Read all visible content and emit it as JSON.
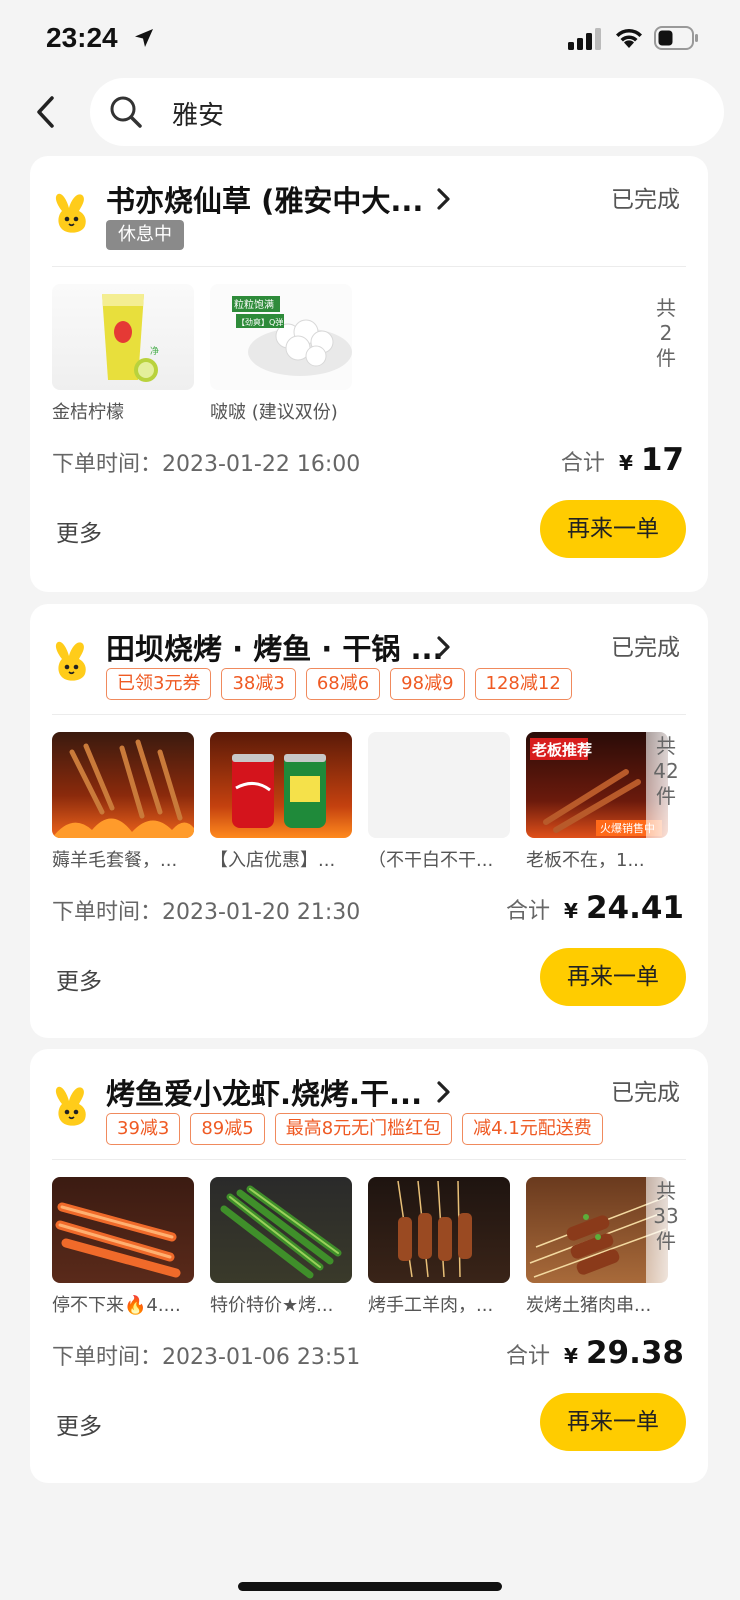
{
  "status_bar": {
    "time": "23:24"
  },
  "search": {
    "query": "雅安"
  },
  "orders": [
    {
      "shop_name": "书亦烧仙草 (雅安中大...",
      "status": "已完成",
      "rest_tag": "休息中",
      "tags": [],
      "items": [
        {
          "name": "金桔柠檬"
        },
        {
          "name": "啵啵 (建议双份)",
          "overlay_text_1": "粒粒饱满",
          "overlay_text_2": "【劲爽】Q弹"
        }
      ],
      "count_prefix": "共",
      "count": "2",
      "count_suffix": "件",
      "order_time_label": "下单时间：",
      "order_time": "2023-01-22 16:00",
      "total_label": "合计",
      "currency": "¥",
      "total": "17",
      "more_label": "更多",
      "reorder_label": "再来一单"
    },
    {
      "shop_name": "田坝烧烤 · 烤鱼 · 干锅 ...",
      "status": "已完成",
      "tags": [
        "已领3元券",
        "38减3",
        "68减6",
        "98减9",
        "128减12"
      ],
      "items": [
        {
          "name": "薅羊毛套餐，..."
        },
        {
          "name": "【入店优惠】..."
        },
        {
          "name": "（不干白不干..."
        },
        {
          "name": "老板不在，1...",
          "overlay_text_1": "老板推荐",
          "overlay_text_2": "火爆销售中"
        }
      ],
      "count_prefix": "共",
      "count": "42",
      "count_suffix": "件",
      "order_time_label": "下单时间：",
      "order_time": "2023-01-20 21:30",
      "total_label": "合计",
      "currency": "¥",
      "total": "24.41",
      "more_label": "更多",
      "reorder_label": "再来一单"
    },
    {
      "shop_name": "烤鱼爱小龙虾.烧烤.干...",
      "status": "已完成",
      "tags": [
        "39减3",
        "89减5",
        "最高8元无门槛红包",
        "减4.1元配送费"
      ],
      "items": [
        {
          "name": "停不下来🔥4...."
        },
        {
          "name": "特价特价★烤..."
        },
        {
          "name": "烤手工羊肉，..."
        },
        {
          "name": "炭烤土猪肉串..."
        }
      ],
      "count_prefix": "共",
      "count": "33",
      "count_suffix": "件",
      "order_time_label": "下单时间：",
      "order_time": "2023-01-06 23:51",
      "total_label": "合计",
      "currency": "¥",
      "total": "29.38",
      "more_label": "更多",
      "reorder_label": "再来一单"
    }
  ]
}
